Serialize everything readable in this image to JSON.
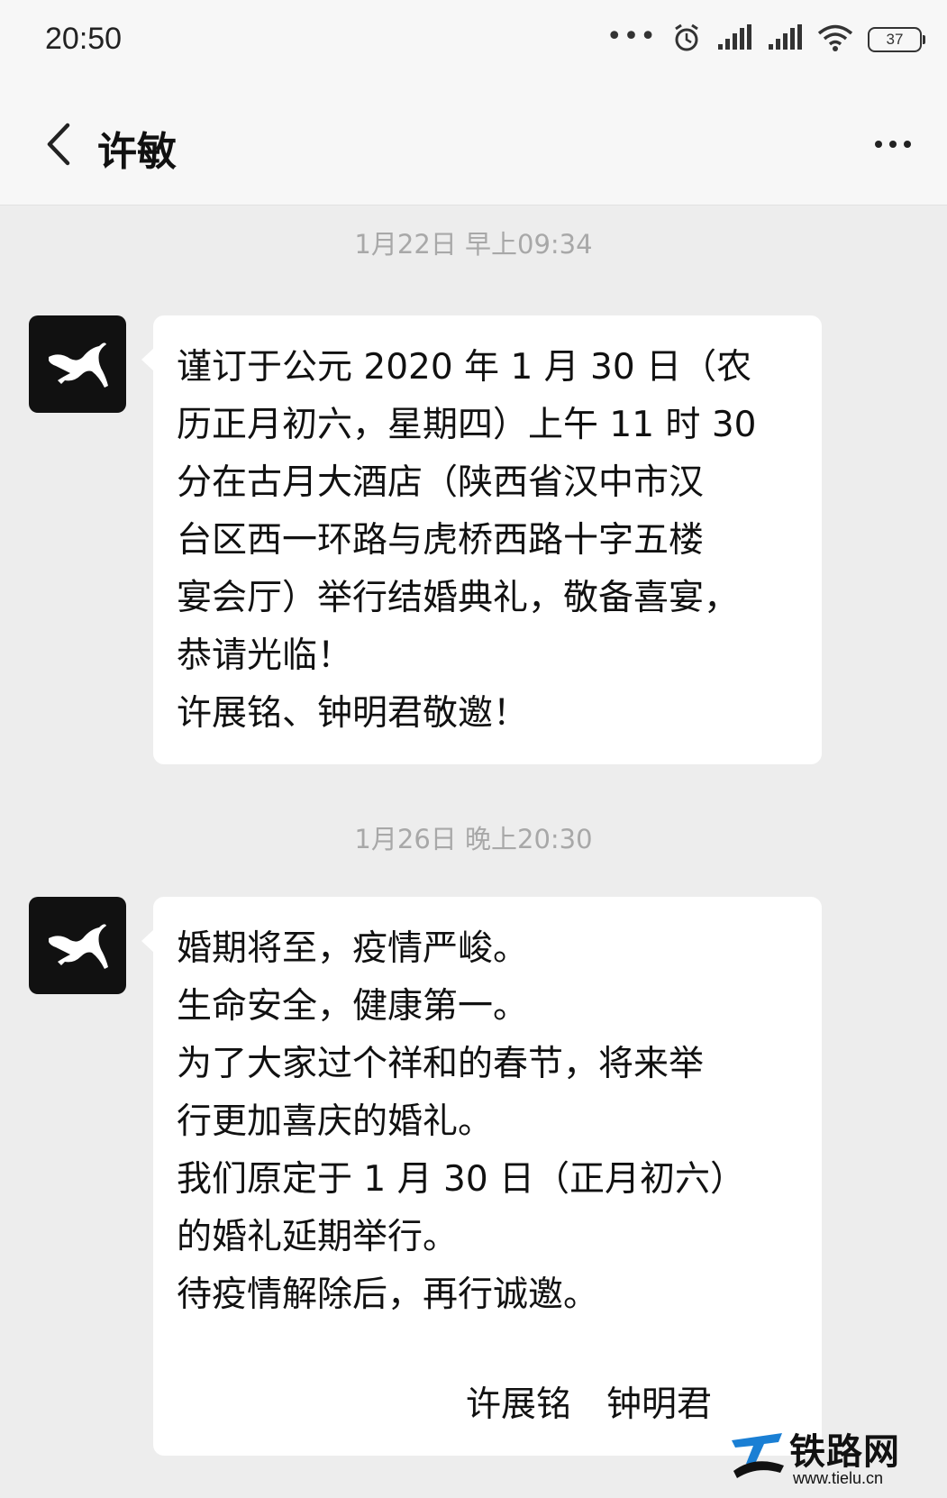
{
  "status_bar": {
    "time": "20:50",
    "icons": [
      "more-dots-icon",
      "alarm-icon",
      "signal-icon",
      "signal-icon",
      "wifi-icon"
    ],
    "battery": "37"
  },
  "header": {
    "back_icon": "chevron-left-icon",
    "title": "许敏",
    "more_icon": "more-horizontal-icon"
  },
  "messages": [
    {
      "timestamp": "1月22日 早上09:34",
      "avatar_icon": "puma-logo-icon",
      "lines": [
        "谨订于公元 2020 年 1 月 30 日（农",
        "历正月初六，星期四）上午 11 时 30",
        "分在古月大酒店（陕西省汉中市汉",
        "台区西一环路与虎桥西路十字五楼",
        "宴会厅）举行结婚典礼，敬备喜宴，",
        "恭请光临！",
        "许展铭、钟明君敬邀！"
      ]
    },
    {
      "timestamp": "1月26日 晚上20:30",
      "avatar_icon": "puma-logo-icon",
      "lines": [
        "婚期将至，疫情严峻。",
        "生命安全，健康第一。",
        "为了大家过个祥和的春节，将来举",
        "行更加喜庆的婚礼。",
        "我们原定于 1 月 30 日（正月初六）",
        "的婚礼延期举行。",
        "待疫情解除后，再行诚邀。"
      ],
      "signature": "许展铭　钟明君"
    }
  ],
  "watermark": {
    "name": "铁路网",
    "url": "www.tielu.cn"
  }
}
